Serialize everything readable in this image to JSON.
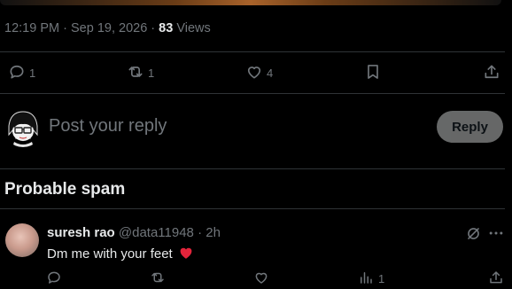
{
  "tweet": {
    "time": "12:19 PM",
    "date": "Sep 19, 2026",
    "dot": "·",
    "views_count": "83",
    "views_label": "Views"
  },
  "actions": {
    "replies": "1",
    "reposts": "1",
    "likes": "4"
  },
  "reply_box": {
    "placeholder": "Post your reply",
    "button_label": "Reply"
  },
  "section": {
    "title": "Probable spam"
  },
  "spam_post": {
    "display_name": "suresh rao",
    "handle": "@data11948",
    "separator": "·",
    "time": "2h",
    "text": "Dm me with your feet",
    "views": "1"
  },
  "colors": {
    "background": "#000000",
    "text": "#e7e9ea",
    "muted": "#71767b",
    "divider": "#2f3336",
    "heart": "#f91880"
  },
  "icons": [
    "reply-icon",
    "repost-icon",
    "like-icon",
    "bookmark-icon",
    "share-icon",
    "grok-icon",
    "more-icon",
    "views-icon"
  ]
}
